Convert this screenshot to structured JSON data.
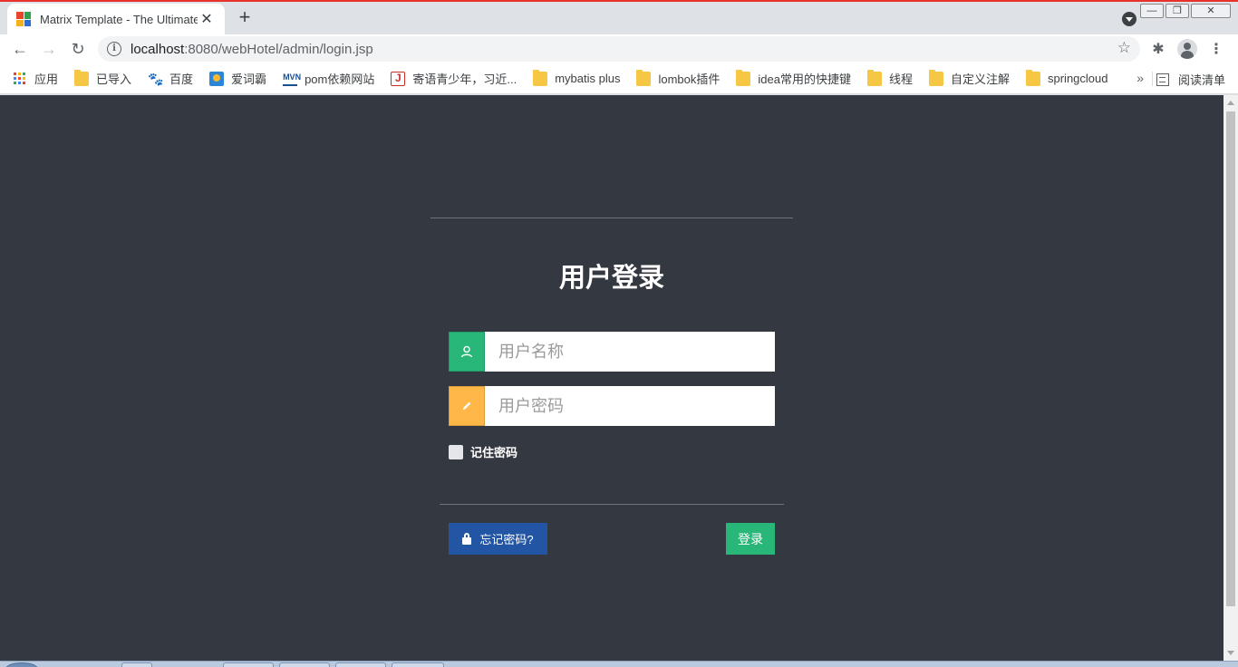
{
  "browser": {
    "tab": {
      "title": "Matrix Template - The Ultimate",
      "close": "✕"
    },
    "new_tab": "+",
    "window_controls": {
      "minimize": "—",
      "restore": "❐",
      "close": "✕"
    },
    "toolbar": {
      "back": "←",
      "forward": "→",
      "reload": "↻",
      "url_host": "localhost",
      "url_rest": ":8080/webHotel/admin/login.jsp",
      "info": "i",
      "star": "☆",
      "extensions": "✱",
      "menu": "⋮"
    },
    "bookmarks": [
      {
        "label": "应用",
        "icon": "apps-icon"
      },
      {
        "label": "已导入",
        "icon": "folder-icon"
      },
      {
        "label": "百度",
        "icon": "baidu-icon"
      },
      {
        "label": "爱词霸",
        "icon": "iciba-icon"
      },
      {
        "label": "pom依赖网站",
        "icon": "mvn-icon"
      },
      {
        "label": "寄语青少年，习近...",
        "icon": "bookmark-red-icon"
      },
      {
        "label": "mybatis plus",
        "icon": "folder-icon"
      },
      {
        "label": "lombok插件",
        "icon": "folder-icon"
      },
      {
        "label": "idea常用的快捷键",
        "icon": "folder-icon"
      },
      {
        "label": "线程",
        "icon": "folder-icon"
      },
      {
        "label": "自定义注解",
        "icon": "folder-icon"
      },
      {
        "label": "springcloud",
        "icon": "folder-icon"
      }
    ],
    "bookmarks_more": "»",
    "reading_list": "阅读清单"
  },
  "login": {
    "title": "用户登录",
    "username_placeholder": "用户名称",
    "password_placeholder": "用户密码",
    "remember_label": "记住密码",
    "forgot_button": "忘记密码?",
    "login_button": "登录"
  },
  "colors": {
    "page_bg": "#343840",
    "green": "#28b779",
    "yellow": "#ffb848",
    "blue": "#2255a4"
  }
}
